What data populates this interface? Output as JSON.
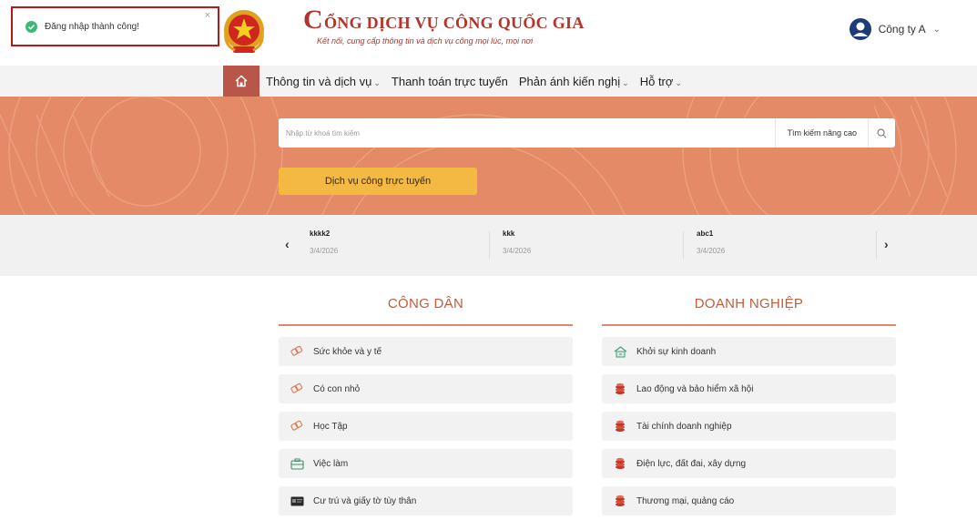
{
  "toast": {
    "message": "Đăng nhập thành công!",
    "close": "×"
  },
  "header": {
    "title_initial": "C",
    "title_rest": "ỔNG DỊCH VỤ CÔNG QUỐC GIA",
    "subtitle": "Kết nối, cung cấp thông tin và dịch vụ công mọi lúc, mọi nơi",
    "user_name": "Công ty A",
    "user_icon": "user-avatar-icon"
  },
  "nav": {
    "home_icon": "home-icon",
    "items": [
      {
        "label": "Thông tin và dịch vụ",
        "dropdown": true
      },
      {
        "label": "Thanh toán trực tuyến",
        "dropdown": false
      },
      {
        "label": "Phản ánh kiến nghị",
        "dropdown": true
      },
      {
        "label": "Hỗ trợ",
        "dropdown": true
      }
    ]
  },
  "search": {
    "placeholder": "Nhập từ khoá tìm kiếm",
    "advanced_label": "Tìm kiếm nâng cao",
    "icon": "search-icon"
  },
  "service_button": "Dịch vụ công trực tuyến",
  "news": [
    {
      "title": "kkkk2",
      "date": "3/4/2026"
    },
    {
      "title": "kkk",
      "date": "3/4/2026"
    },
    {
      "title": "abc1",
      "date": "3/4/2026"
    }
  ],
  "citizen": {
    "title": "CÔNG DÂN",
    "items": [
      {
        "label": "Sức khỏe và y tế",
        "icon": "health-icon"
      },
      {
        "label": "Có con nhỏ",
        "icon": "child-icon"
      },
      {
        "label": "Học Tập",
        "icon": "study-icon"
      },
      {
        "label": "Việc làm",
        "icon": "briefcase-icon"
      },
      {
        "label": "Cư trú và giấy tờ tùy thân",
        "icon": "id-card-icon"
      }
    ]
  },
  "business": {
    "title": "DOANH NGHIỆP",
    "items": [
      {
        "label": "Khởi sự kinh doanh",
        "icon": "startup-icon"
      },
      {
        "label": "Lao động và bảo hiểm xã hội",
        "icon": "coins-icon"
      },
      {
        "label": "Tài chính doanh nghiệp",
        "icon": "coins-icon"
      },
      {
        "label": "Điện lực, đất đai, xây dựng",
        "icon": "coins-icon"
      },
      {
        "label": "Thương mại, quảng cáo",
        "icon": "coins-icon"
      }
    ]
  },
  "colors": {
    "brand_red": "#b3342a",
    "banner_orange": "#e48a66",
    "button_yellow": "#f4b942",
    "nav_home": "#b8564a",
    "toast_border": "#b31b1b",
    "success_green": "#3cb878"
  }
}
